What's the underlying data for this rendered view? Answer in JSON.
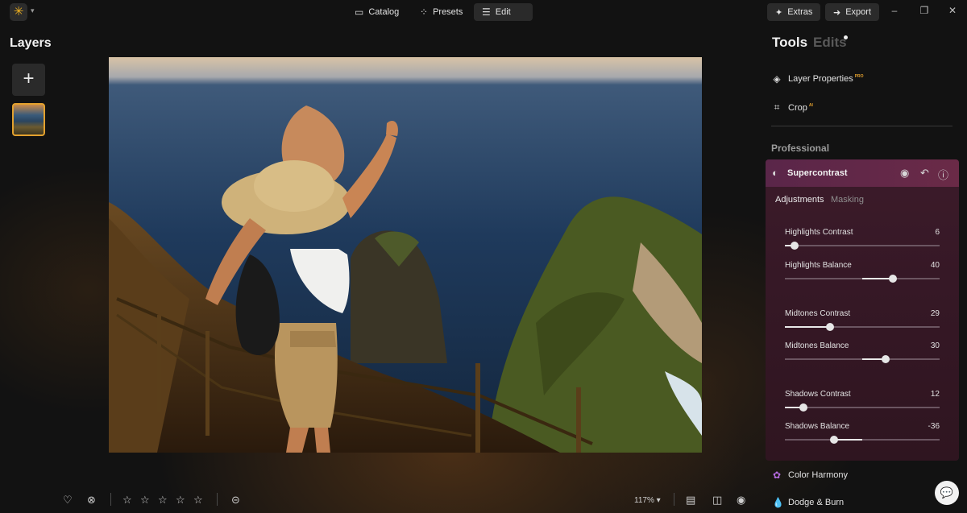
{
  "topbar": {
    "nav": [
      {
        "label": "Catalog",
        "icon": "folder-icon"
      },
      {
        "label": "Presets",
        "icon": "magic-wand-icon"
      },
      {
        "label": "Edit",
        "icon": "sliders-icon",
        "active": true
      }
    ],
    "extras": "Extras",
    "export": "Export"
  },
  "layers": {
    "title": "Layers"
  },
  "bottombar": {
    "zoom": "117%",
    "rating": 0
  },
  "panel": {
    "tabs": [
      "Tools",
      "Edits"
    ],
    "tools": [
      {
        "label": "Layer Properties",
        "badge": "PRO"
      },
      {
        "label": "Crop",
        "badge": "AI"
      },
      {
        "label": "Color Harmony"
      },
      {
        "label": "Dodge & Burn"
      }
    ],
    "section": "Professional"
  },
  "supercontrast": {
    "title": "Supercontrast",
    "tabs": [
      "Adjustments",
      "Masking"
    ],
    "sliders": [
      {
        "label": "Highlights Contrast",
        "value": "6",
        "min": 0,
        "max": 100,
        "bipolar": false
      },
      {
        "label": "Highlights Balance",
        "value": "40",
        "min": -100,
        "max": 100,
        "bipolar": true
      },
      {
        "label": "Midtones Contrast",
        "value": "29",
        "min": 0,
        "max": 100,
        "bipolar": false
      },
      {
        "label": "Midtones Balance",
        "value": "30",
        "min": -100,
        "max": 100,
        "bipolar": true
      },
      {
        "label": "Shadows Contrast",
        "value": "12",
        "min": 0,
        "max": 100,
        "bipolar": false
      },
      {
        "label": "Shadows Balance",
        "value": "-36",
        "min": -100,
        "max": 100,
        "bipolar": true
      }
    ]
  },
  "colors": {
    "accent": "#e3a12e",
    "panel": "#361826",
    "header": "#5a2649"
  }
}
